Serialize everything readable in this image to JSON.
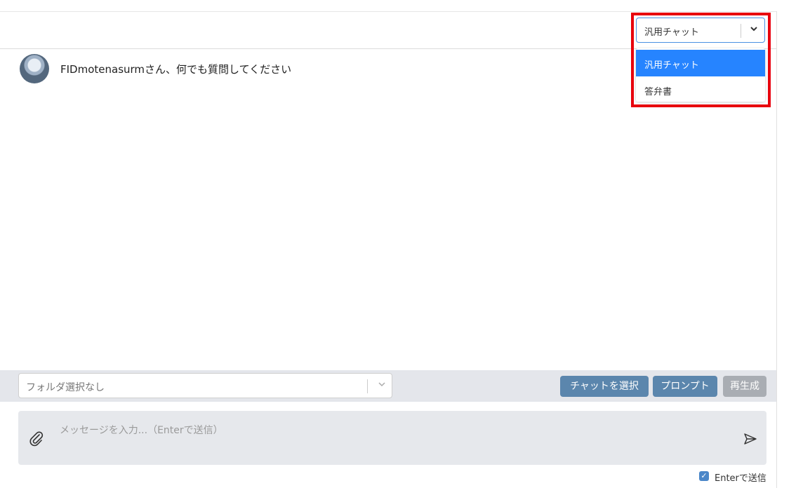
{
  "header": {
    "model_select": {
      "value": "汎用チャット",
      "options": [
        "汎用チャット",
        "答弁書"
      ],
      "selected_index": 0
    }
  },
  "chat": {
    "welcome": "FIDmotenasurmさん、何でも質問してください"
  },
  "toolbar": {
    "folder_placeholder": "フォルダ選択なし",
    "select_chat_label": "チャットを選択",
    "prompt_label": "プロンプト",
    "regenerate_label": "再生成"
  },
  "composer": {
    "placeholder": "メッセージを入力...（Enterで送信）",
    "enter_to_send_label": "Enterで送信",
    "enter_to_send_checked": true
  },
  "colors": {
    "highlight": "#e8000d",
    "selected_option": "#2684ff",
    "button_primary": "#5b86ad",
    "button_disabled": "#a9adb3"
  }
}
